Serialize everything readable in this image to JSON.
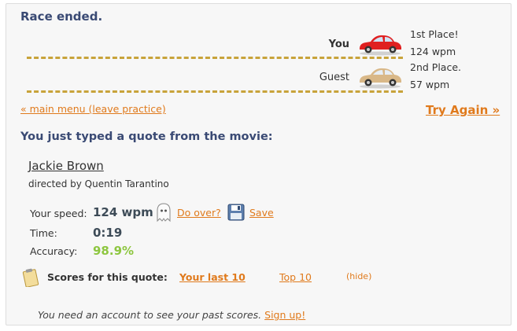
{
  "race": {
    "status": "Race ended.",
    "players": [
      {
        "name": "You",
        "place": "1st Place!",
        "speed": "124 wpm",
        "car_color": "#e02020"
      },
      {
        "name": "Guest",
        "place": "2nd Place.",
        "speed": "57 wpm",
        "car_color": "#d9b888"
      }
    ]
  },
  "nav": {
    "main_menu_link": "« main menu (leave practice)",
    "try_again": "Try Again »"
  },
  "quote": {
    "heading": "You just typed a quote from the movie:",
    "title": "Jackie Brown",
    "credit": "directed by Quentin Tarantino"
  },
  "stats": {
    "speed_label": "Your speed:",
    "speed_value": "124 wpm",
    "do_over": "Do over?",
    "save": "Save",
    "time_label": "Time:",
    "time_value": "0:19",
    "accuracy_label": "Accuracy:",
    "accuracy_value": "98.9%"
  },
  "scores": {
    "label": "Scores for this quote:",
    "tab_last10": "Your last 10",
    "tab_top10": "Top 10",
    "hide": "(hide)"
  },
  "footer": {
    "message": "You need an account to see your past scores.",
    "signup": "Sign up!"
  },
  "colors": {
    "heading": "#3a4a74",
    "link": "#e07a1c",
    "track": "#c8a33a",
    "accuracy": "#8dc63f"
  }
}
